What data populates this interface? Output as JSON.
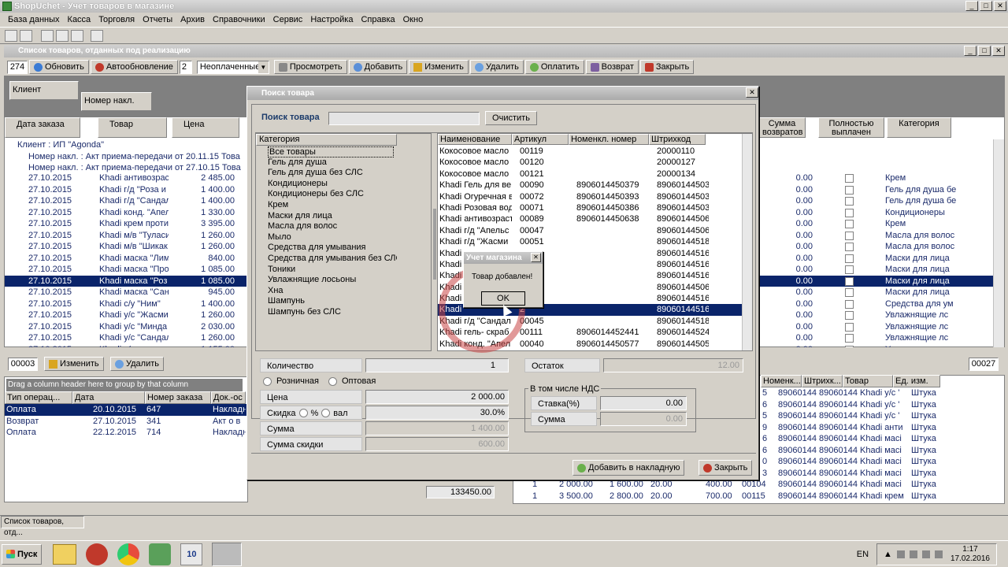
{
  "window": {
    "title": "ShopUchet - Учет товаров в магазине"
  },
  "menu": [
    "База данных",
    "Касса",
    "Торговля",
    "Отчеты",
    "Архив",
    "Справочники",
    "Сервис",
    "Настройка",
    "Справка",
    "Окно"
  ],
  "mdi": {
    "title": "Список товаров, отданных под реализацию"
  },
  "toolbar": {
    "count": "274",
    "refresh": "Обновить",
    "autorefresh": "Автообновление",
    "autorefresh_val": "2",
    "filter": "Неоплаченные",
    "view": "Просмотреть",
    "add": "Добавить",
    "edit": "Изменить",
    "delete": "Удалить",
    "pay": "Оплатить",
    "return": "Возврат",
    "close": "Закрыть"
  },
  "groupby": {
    "client": "Клиент",
    "nakl": "Номер накл."
  },
  "main_headers": [
    "Дата заказа",
    "Товар",
    "Цена"
  ],
  "right_headers": [
    "Сумма возвратов",
    "Полностью выплачен",
    "Категория"
  ],
  "group_rows": [
    "Клиент : ИП \"Agonda\"",
    "Номер накл. : Акт приема-передачи от 20.11.15 Това",
    "Номер накл. : Акт приема-передачи от 27.10.15 Това"
  ],
  "main_rows": [
    {
      "d": "27.10.2015",
      "t": "Khadi антивозраст",
      "p": "2 485.00",
      "s": "0.00",
      "c": "Крем"
    },
    {
      "d": "27.10.2015",
      "t": "Khadi г/д \"Роза и",
      "p": "1 400.00",
      "s": "0.00",
      "c": "Гель для душа бе"
    },
    {
      "d": "27.10.2015",
      "t": "Khadi г/д \"Сандал",
      "p": "1 400.00",
      "s": "0.00",
      "c": "Гель для душа бе"
    },
    {
      "d": "27.10.2015",
      "t": "Khadi конд. \"Апел",
      "p": "1 330.00",
      "s": "0.00",
      "c": "Кондиционеры"
    },
    {
      "d": "27.10.2015",
      "t": "Khadi крем проти",
      "p": "3 395.00",
      "s": "0.00",
      "c": "Крем"
    },
    {
      "d": "27.10.2015",
      "t": "Khadi м/в \"Туласи",
      "p": "1 260.00",
      "s": "0.00",
      "c": "Масла для волос"
    },
    {
      "d": "27.10.2015",
      "t": "Khadi м/в \"Шикак",
      "p": "1 260.00",
      "s": "0.00",
      "c": "Масла для волос"
    },
    {
      "d": "27.10.2015",
      "t": "Khadi маска \"Лим",
      "p": "840.00",
      "s": "0.00",
      "c": "Маски для лица"
    },
    {
      "d": "27.10.2015",
      "t": "Khadi маска \"Про",
      "p": "1 085.00",
      "s": "0.00",
      "c": "Маски для лица"
    },
    {
      "d": "27.10.2015",
      "t": "Khadi маска \"Роз",
      "p": "1 085.00",
      "s": "0.00",
      "c": "Маски для лица",
      "sel": true
    },
    {
      "d": "27.10.2015",
      "t": "Khadi маска \"Сан",
      "p": "945.00",
      "s": "0.00",
      "c": "Маски для лица"
    },
    {
      "d": "27.10.2015",
      "t": "Khadi с/у \"Ним\"",
      "p": "1 400.00",
      "s": "0.00",
      "c": "Средства для ум"
    },
    {
      "d": "27.10.2015",
      "t": "Khadi у/с \"Жасми",
      "p": "1 260.00",
      "s": "0.00",
      "c": "Увлажнящие лс"
    },
    {
      "d": "27.10.2015",
      "t": "Khadi у/с \"Минда",
      "p": "2 030.00",
      "s": "0.00",
      "c": "Увлажнящие лс"
    },
    {
      "d": "27.10.2015",
      "t": "Khadi у/с \"Сандал",
      "p": "1 260.00",
      "s": "0.00",
      "c": "Увлажнящие лс"
    },
    {
      "d": "27.10.2015",
      "t": "Khadi у/с",
      "p": "1 155.00",
      "s": "0.00",
      "c": "Увлажнящие лс"
    }
  ],
  "mid": {
    "left_code": "00003",
    "edit": "Изменить",
    "delete": "Удалить",
    "right_code": "00027"
  },
  "payments": {
    "hint": "Drag a column header here to group by that column",
    "headers": [
      "Тип операц...",
      "Дата",
      "Номер заказа",
      "Док.-ос"
    ],
    "rows": [
      [
        "Оплата",
        "20.10.2015",
        "647",
        "Накладн"
      ],
      [
        "Возврат",
        "27.10.2015",
        "341",
        "Акт о в"
      ],
      [
        "Оплата",
        "22.12.2015",
        "714",
        "Накладн"
      ]
    ],
    "total": "133450.00"
  },
  "detail": {
    "headers": [
      "Номенк...",
      "Штрихк...",
      "Товар",
      "Ед. изм."
    ],
    "rows": [
      {
        "a": "5",
        "n": "89060144",
        "b": "89060144",
        "t": "Khadi у/с '",
        "u": "Штука",
        "sel": true
      },
      {
        "a": "6",
        "n": "89060144",
        "b": "89060144",
        "t": "Khadi у/с '",
        "u": "Штука"
      },
      {
        "a": "5",
        "n": "89060144",
        "b": "89060144",
        "t": "Khadi у/с '",
        "u": "Штука"
      },
      {
        "a": "9",
        "n": "89060144",
        "b": "89060144",
        "t": "Khadi анти",
        "u": "Штука"
      },
      {
        "a": "6",
        "n": "89060144",
        "b": "89060144",
        "t": "Khadi масі",
        "u": "Штука"
      },
      {
        "a": "6",
        "n": "89060144",
        "b": "89060144",
        "t": "Khadi масі",
        "u": "Штука"
      },
      {
        "a": "0",
        "n": "89060144",
        "b": "89060144",
        "t": "Khadi масі",
        "u": "Штука"
      },
      {
        "a": "3",
        "n": "89060144",
        "b": "89060144",
        "t": "Khadi масі",
        "u": "Штука"
      }
    ],
    "tail": [
      {
        "q": "1",
        "p1": "2 000.00",
        "p2": "1 600.00",
        "pct": "20.00",
        "sum": "400.00",
        "code": "00104",
        "n": "89060144",
        "b": "89060144",
        "t": "Khadi масі",
        "u": "Штука"
      },
      {
        "q": "1",
        "p1": "3 500.00",
        "p2": "2 800.00",
        "pct": "20.00",
        "sum": "700.00",
        "code": "00115",
        "n": "89060144",
        "b": "89060144",
        "t": "Khadi крем",
        "u": "Штука"
      }
    ]
  },
  "dialog": {
    "title": "Поиск товара",
    "search_label": "Поиск товара",
    "search_value": "",
    "clear": "Очистить",
    "category_header": "Категория",
    "categories": [
      "Все товары",
      "Гель для душа",
      "Гель для душа без СЛС",
      "Кондиционеры",
      "Кондиционеры без СЛС",
      "Крем",
      "Маски для лица",
      "Масла для волос",
      "Мыло",
      "Средства для умывания",
      "Средства для умывания без СЛС",
      "Тоники",
      "Увлажнящие лосьоны",
      "Хна",
      "Шампунь",
      "Шампунь без СЛС"
    ],
    "prod_headers": [
      "Наименование",
      "Артикул",
      "Номенкл. номер",
      "Штрихкод"
    ],
    "products": [
      {
        "n": "Кокосовое масло",
        "a": "00119",
        "nn": "",
        "b": "20000110"
      },
      {
        "n": "Кокосовое масло",
        "a": "00120",
        "nn": "",
        "b": "20000127"
      },
      {
        "n": "Кокосовое масло",
        "a": "00121",
        "nn": "",
        "b": "20000134"
      },
      {
        "n": "Khadi Гель для ве",
        "a": "00090",
        "nn": "8906014450379",
        "b": "890601445030"
      },
      {
        "n": "Khadi Огуречная в",
        "a": "00072",
        "nn": "8906014450393",
        "b": "890601445030"
      },
      {
        "n": "Khadi Розовая вод",
        "a": "00071",
        "nn": "8906014450386",
        "b": "890601445030"
      },
      {
        "n": "Khadi антивозраст",
        "a": "00089",
        "nn": "8906014450638",
        "b": "890601445060"
      },
      {
        "n": "Khadi г/д \"Апельс",
        "a": "00047",
        "nn": "",
        "b": "890601445060"
      },
      {
        "n": "Khadi г/д \"Жасми",
        "a": "00051",
        "nn": "",
        "b": "890601445180"
      },
      {
        "n": "Khadi",
        "a": "",
        "nn": "",
        "b": "890601445160"
      },
      {
        "n": "Khadi",
        "a": "4",
        "nn": "",
        "b": "890601445160"
      },
      {
        "n": "Khadi",
        "a": "8",
        "nn": "",
        "b": "890601445160"
      },
      {
        "n": "Khadi",
        "a": "8",
        "nn": "",
        "b": "890601445060"
      },
      {
        "n": "Khadi",
        "a": "",
        "nn": "",
        "b": "890601445160"
      },
      {
        "n": "Khadi",
        "a": "2",
        "nn": "",
        "b": "890601445160",
        "sel": true
      },
      {
        "n": "Khadi г/д \"Сандал",
        "a": "00045",
        "nn": "",
        "b": "890601445180"
      },
      {
        "n": "Khadi гель- скраб",
        "a": "00111",
        "nn": "8906014452441",
        "b": "890601445240"
      },
      {
        "n": "Khadi конд. \"Апел",
        "a": "00040",
        "nn": "8906014450577",
        "b": "890601445050"
      }
    ],
    "qty_label": "Количество",
    "qty": "1",
    "stock_label": "Остаток",
    "stock": "12.00",
    "retail": "Розничная",
    "wholesale": "Оптовая",
    "price_label": "Цена",
    "price": "2 000.00",
    "disc_label": "Скидка",
    "pct": "%",
    "val": "вал",
    "disc": "30.0%",
    "sum_label": "Сумма",
    "sum": "1 400.00",
    "sumdisc_label": "Сумма скидки",
    "sumdisc": "600.00",
    "vat_group": "В том числе НДС",
    "vat_rate_label": "Ставка(%)",
    "vat_rate": "0.00",
    "vat_sum_label": "Сумма",
    "vat_sum": "0.00",
    "add_btn": "Добавить в накладную",
    "close_btn": "Закрыть"
  },
  "msg": {
    "title": "Учет магазина",
    "text": "Товар добавлен!",
    "ok": "OK"
  },
  "status": {
    "tab": "Список товаров, отд..."
  },
  "taskbar": {
    "start": "Пуск",
    "lang": "EN",
    "time": "1:17",
    "date": "17.02.2016"
  }
}
